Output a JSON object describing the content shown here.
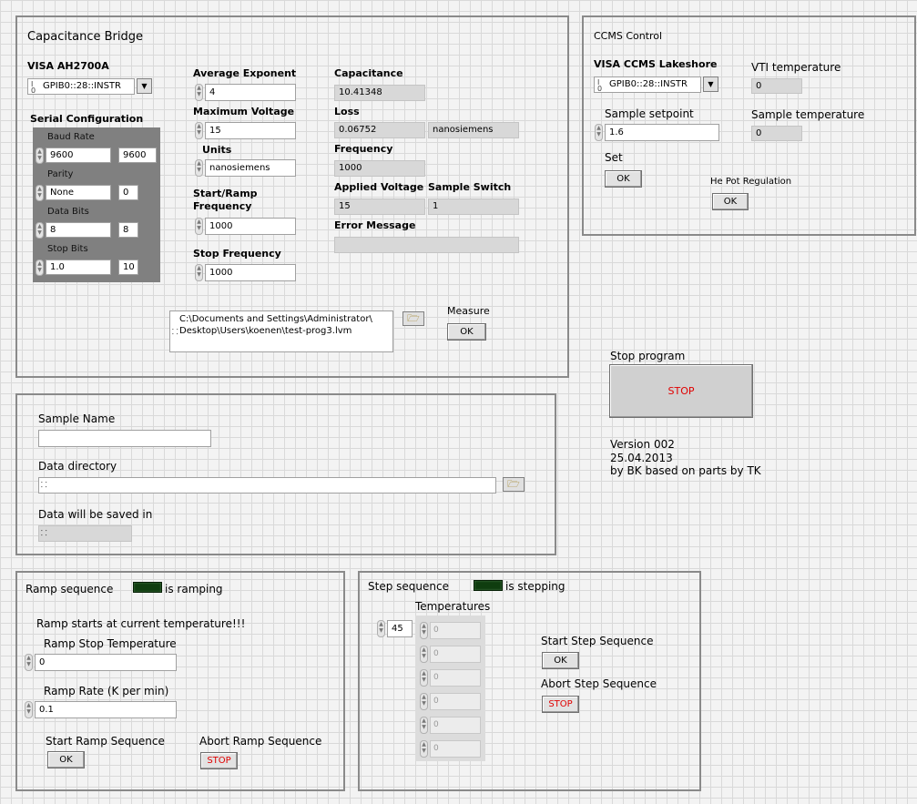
{
  "cap_bridge": {
    "title": "Capacitance Bridge",
    "visa_label": "VISA AH2700A",
    "visa_value": "GPIB0::28::INSTR",
    "serial": {
      "title": "Serial Configuration",
      "baud_label": "Baud Rate",
      "baud_value": "9600",
      "baud_ind": "9600",
      "parity_label": "Parity",
      "parity_value": "None",
      "parity_ind": "0",
      "databits_label": "Data Bits",
      "databits_value": "8",
      "databits_ind": "8",
      "stopbits_label": "Stop Bits",
      "stopbits_value": "1.0",
      "stopbits_ind": "10"
    },
    "avg_exp_label": "Average Exponent",
    "avg_exp_value": "4",
    "max_volt_label": "Maximum Voltage",
    "max_volt_value": "15",
    "units_label": "Units",
    "units_value": "nanosiemens",
    "start_freq_label_1": "Start/Ramp",
    "start_freq_label_2": "Frequency",
    "start_freq_value": "1000",
    "stop_freq_label": "Stop  Frequency",
    "stop_freq_value": "1000",
    "capacitance_label": "Capacitance",
    "capacitance_value": "10.41348",
    "loss_label": "Loss",
    "loss_value": "0.06752",
    "loss_unit": "nanosiemens",
    "frequency_label": "Frequency",
    "frequency_value": "1000",
    "applied_voltage_label": "Applied Voltage",
    "applied_voltage_value": "15",
    "sample_switch_label": "Sample Switch",
    "sample_switch_value": "1",
    "error_label": "Error Message",
    "error_value": "",
    "file_path_1": "C:\\Documents and Settings\\Administrator\\",
    "file_path_2": "Desktop\\Users\\koenen\\test-prog3.lvm",
    "measure_label": "Measure",
    "measure_btn": "OK"
  },
  "ccms": {
    "title": "CCMS Control",
    "visa_label": "VISA CCMS Lakeshore",
    "visa_value": "GPIB0::28::INSTR",
    "vti_label": "VTI temperature",
    "vti_value": "0",
    "setpoint_label": "Sample setpoint",
    "setpoint_value": "1.6",
    "sample_temp_label": "Sample temperature",
    "sample_temp_value": "0",
    "set_label": "Set",
    "set_btn": "OK",
    "hepot_label": "He Pot Regulation",
    "hepot_btn": "OK"
  },
  "stop_program": {
    "label": "Stop program",
    "button": "STOP",
    "version_1": "Version 002",
    "version_2": "25.04.2013",
    "version_3": "by BK based on parts by TK"
  },
  "sample": {
    "name_label": "Sample Name",
    "name_value": "",
    "dir_label": "Data directory",
    "dir_value": "",
    "saved_label": "Data will be saved in",
    "saved_value": ""
  },
  "ramp": {
    "title": "Ramp sequence",
    "led_label": "is ramping",
    "note": "Ramp starts at current temperature!!!",
    "stop_temp_label": "Ramp Stop Temperature",
    "stop_temp_value": "0",
    "rate_label": "Ramp Rate (K per min)",
    "rate_value": "0.1",
    "start_label": "Start Ramp Sequence",
    "start_btn": "OK",
    "abort_label": "Abort Ramp Sequence",
    "abort_btn": "STOP"
  },
  "step": {
    "title": "Step sequence",
    "led_label": "is stepping",
    "temps_label": "Temperatures",
    "index_value": "45",
    "temps": [
      "0",
      "0",
      "0",
      "0",
      "0",
      "0"
    ],
    "start_label": "Start Step Sequence",
    "start_btn": "OK",
    "abort_label": "Abort Step Sequence",
    "abort_btn": "STOP"
  },
  "icons": {
    "spinner": "spinner-arrows-icon",
    "dropdown": "chevron-down-icon",
    "folder": "folder-open-icon",
    "led": "led-indicator-icon",
    "path": "path-icon"
  }
}
